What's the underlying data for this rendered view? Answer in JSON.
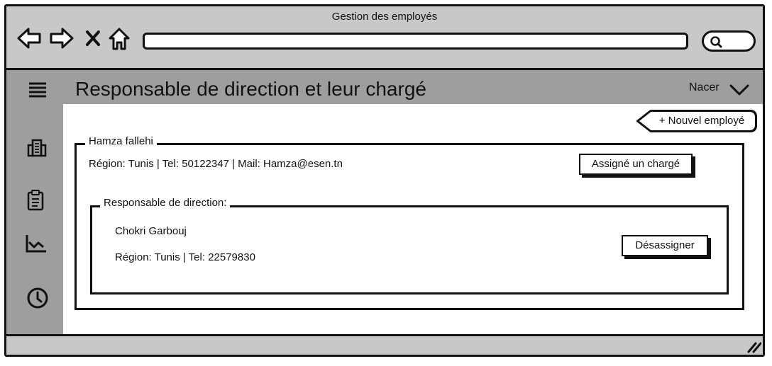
{
  "window": {
    "title": "Gestion des employés"
  },
  "browser": {
    "nav": [
      "back-icon",
      "forward-icon",
      "close-icon",
      "home-icon"
    ],
    "url_value": "",
    "search_icon": "search-icon"
  },
  "header": {
    "title": "Responsable de direction et leur chargé",
    "user_name": "Nacer",
    "menu_icon": "hamburger-icon"
  },
  "sidebar": {
    "items": [
      "building-icon",
      "clipboard-icon",
      "chart-icon",
      "clock-icon"
    ]
  },
  "actions": {
    "new_employee": "+ Nouvel employé"
  },
  "employee": {
    "name": "Hamza fallehi",
    "info": "Région: Tunis | Tel: 50122347 | Mail: Hamza@esen.tn",
    "assign_label": "Assigné un chargé"
  },
  "manager": {
    "legend": "Responsable de direction:",
    "name": "Chokri Garbouj",
    "info": "Région: Tunis | Tel: 22579830",
    "unassign_label": "Désassigner"
  }
}
